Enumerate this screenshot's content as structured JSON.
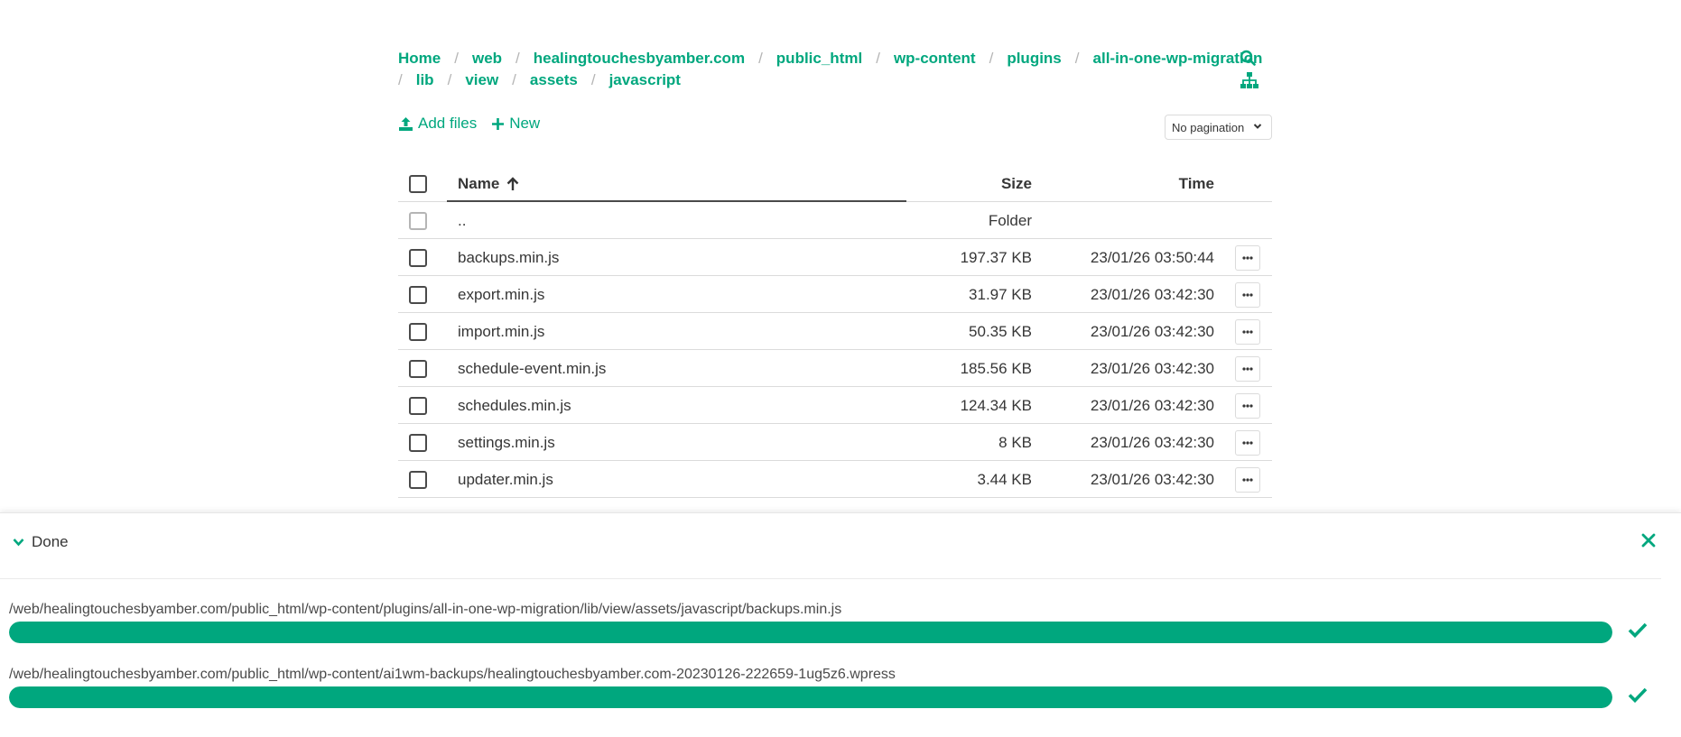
{
  "breadcrumb": {
    "line1": [
      "Home",
      "web",
      "healingtouchesbyamber.com",
      "public_html",
      "wp-content",
      "plugins",
      "all-in-one-wp-migration"
    ],
    "line2": [
      "lib",
      "view",
      "assets",
      "javascript"
    ],
    "separator": "/"
  },
  "toolbar": {
    "add_files_label": "Add files",
    "new_label": "New",
    "pagination_value": "No pagination"
  },
  "table": {
    "columns": {
      "name": "Name",
      "size": "Size",
      "time": "Time"
    },
    "parent_row": {
      "name": "..",
      "size": "Folder"
    },
    "rows": [
      {
        "name": "backups.min.js",
        "size": "197.37 KB",
        "time": "23/01/26 03:50:44"
      },
      {
        "name": "export.min.js",
        "size": "31.97 KB",
        "time": "23/01/26 03:42:30"
      },
      {
        "name": "import.min.js",
        "size": "50.35 KB",
        "time": "23/01/26 03:42:30"
      },
      {
        "name": "schedule-event.min.js",
        "size": "185.56 KB",
        "time": "23/01/26 03:42:30"
      },
      {
        "name": "schedules.min.js",
        "size": "124.34 KB",
        "time": "23/01/26 03:42:30"
      },
      {
        "name": "settings.min.js",
        "size": "8 KB",
        "time": "23/01/26 03:42:30"
      },
      {
        "name": "updater.min.js",
        "size": "3.44 KB",
        "time": "23/01/26 03:42:30"
      }
    ]
  },
  "upload_panel": {
    "status_label": "Done",
    "uploads": [
      {
        "path": "/web/healingtouchesbyamber.com/public_html/wp-content/plugins/all-in-one-wp-migration/lib/view/assets/javascript/backups.min.js",
        "progress_percent": 100
      },
      {
        "path": "/web/healingtouchesbyamber.com/public_html/wp-content/ai1wm-backups/healingtouchesbyamber.com-20230126-222659-1ug5z6.wpress",
        "progress_percent": 100
      }
    ]
  },
  "icons": {
    "search": "search-icon",
    "tree": "sitemap-icon",
    "upload": "upload-icon",
    "plus": "plus-icon",
    "sort": "arrow-up-icon",
    "more": "ellipsis-icon",
    "collapse": "chevron-down-icon",
    "close": "close-icon",
    "check": "check-icon"
  },
  "colors": {
    "accent": "#00a77e",
    "text": "#363636",
    "border": "#dbdbdb"
  }
}
